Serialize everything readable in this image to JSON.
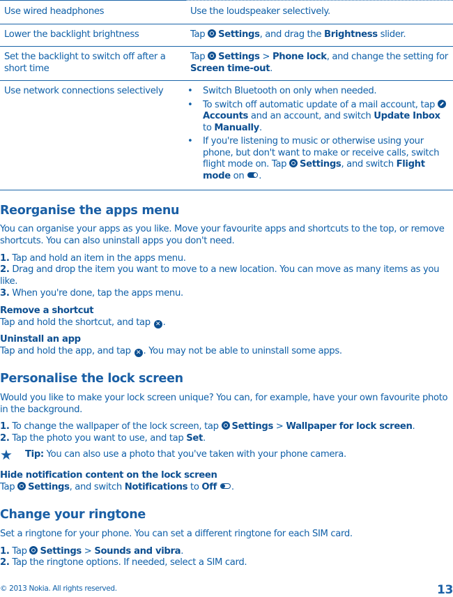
{
  "table": {
    "rows": [
      {
        "left": "Use wired headphones",
        "right": [
          {
            "t": "Use the loudspeaker selectively."
          }
        ]
      },
      {
        "left": "Lower the backlight brightness",
        "right": [
          {
            "t": "Tap "
          },
          {
            "icon": "settings-icon"
          },
          {
            "t": "Settings",
            "b": true
          },
          {
            "t": ", and drag the "
          },
          {
            "t": "Brightness",
            "b": true
          },
          {
            "t": " slider."
          }
        ]
      },
      {
        "left": "Set the backlight to switch off after a short time",
        "right": [
          {
            "t": "Tap "
          },
          {
            "icon": "settings-icon"
          },
          {
            "t": "Settings",
            "b": true
          },
          {
            "t": " > "
          },
          {
            "t": "Phone lock",
            "b": true
          },
          {
            "t": ", and change the setting for "
          },
          {
            "t": "Screen time-out",
            "b": true
          },
          {
            "t": "."
          }
        ]
      },
      {
        "left": "Use network connections selectively",
        "bullets": [
          [
            {
              "t": "Switch Bluetooth on only when needed."
            }
          ],
          [
            {
              "t": "To switch off automatic update of a mail account, tap "
            },
            {
              "icon": "accounts-icon"
            },
            {
              "t": "Accounts",
              "b": true
            },
            {
              "t": " and an account, and switch "
            },
            {
              "t": "Update Inbox",
              "b": true
            },
            {
              "t": " to "
            },
            {
              "t": "Manually",
              "b": true
            },
            {
              "t": "."
            }
          ],
          [
            {
              "t": "If you're listening to music or otherwise using your phone, but don't want to make or receive calls, switch flight mode on. Tap "
            },
            {
              "icon": "settings-icon"
            },
            {
              "t": "Settings",
              "b": true
            },
            {
              "t": ", and switch "
            },
            {
              "t": "Flight mode",
              "b": true
            },
            {
              "t": " on "
            },
            {
              "icon": "toggle-on-icon"
            },
            {
              "t": "."
            }
          ]
        ]
      }
    ]
  },
  "sections": {
    "apps": {
      "title": "Reorganise the apps menu",
      "intro": [
        {
          "t": "You can organise your apps as you like. Move your favourite apps and shortcuts to the top, or remove shortcuts. You can also uninstall apps you don't need."
        }
      ],
      "steps": [
        [
          {
            "t": "1.",
            "b": true
          },
          {
            "t": " Tap and hold an item in the apps menu."
          }
        ],
        [
          {
            "t": "2.",
            "b": true
          },
          {
            "t": " Drag and drop the item you want to move to a new location. You can move as many items as you like."
          }
        ],
        [
          {
            "t": "3.",
            "b": true
          },
          {
            "t": " When you're done, tap the apps menu."
          }
        ]
      ],
      "remove_title": "Remove a shortcut",
      "remove_text": [
        {
          "t": "Tap and hold the shortcut, and tap "
        },
        {
          "icon": "close-icon"
        },
        {
          "t": "."
        }
      ],
      "uninstall_title": "Uninstall an app",
      "uninstall_text": [
        {
          "t": "Tap and hold the app, and tap "
        },
        {
          "icon": "close-icon"
        },
        {
          "t": ". You may not be able to uninstall some apps."
        }
      ]
    },
    "lock": {
      "title": "Personalise the lock screen",
      "intro": [
        {
          "t": "Would you like to make your lock screen unique? You can, for example, have your own favourite photo in the background."
        }
      ],
      "steps": [
        [
          {
            "t": "1.",
            "b": true
          },
          {
            "t": " To change the wallpaper of the lock screen, tap "
          },
          {
            "icon": "settings-icon"
          },
          {
            "t": "Settings",
            "b": true
          },
          {
            "t": " > "
          },
          {
            "t": "Wallpaper for lock screen",
            "b": true
          },
          {
            "t": "."
          }
        ],
        [
          {
            "t": "2.",
            "b": true
          },
          {
            "t": " Tap the photo you want to use, and tap "
          },
          {
            "t": "Set",
            "b": true
          },
          {
            "t": "."
          }
        ]
      ],
      "tip": [
        {
          "t": "Tip:",
          "b": true
        },
        {
          "t": " You can also use a photo that you've taken with your phone camera."
        }
      ],
      "hide_title": "Hide notification content on the lock screen",
      "hide_text": [
        {
          "t": "Tap "
        },
        {
          "icon": "settings-icon"
        },
        {
          "t": "Settings",
          "b": true
        },
        {
          "t": ", and switch "
        },
        {
          "t": "Notifications",
          "b": true
        },
        {
          "t": " to "
        },
        {
          "t": "Off",
          "b": true
        },
        {
          "t": " "
        },
        {
          "icon": "toggle-off-icon"
        },
        {
          "t": "."
        }
      ]
    },
    "ringtone": {
      "title": "Change your ringtone",
      "intro": [
        {
          "t": "Set a ringtone for your phone. You can set a different ringtone for each SIM card."
        }
      ],
      "steps": [
        [
          {
            "t": "1.",
            "b": true
          },
          {
            "t": " Tap "
          },
          {
            "icon": "settings-icon"
          },
          {
            "t": "Settings",
            "b": true
          },
          {
            "t": " > "
          },
          {
            "t": "Sounds and vibra",
            "b": true
          },
          {
            "t": "."
          }
        ],
        [
          {
            "t": "2.",
            "b": true
          },
          {
            "t": " Tap the ringtone options. If needed, select a SIM card."
          }
        ]
      ]
    }
  },
  "footer": {
    "copyright": "© 2013 Nokia. All rights reserved.",
    "page": "13"
  },
  "colors": {
    "text": "#1060a8",
    "bold": "#0d4f91",
    "heading": "#1a5fa5"
  }
}
